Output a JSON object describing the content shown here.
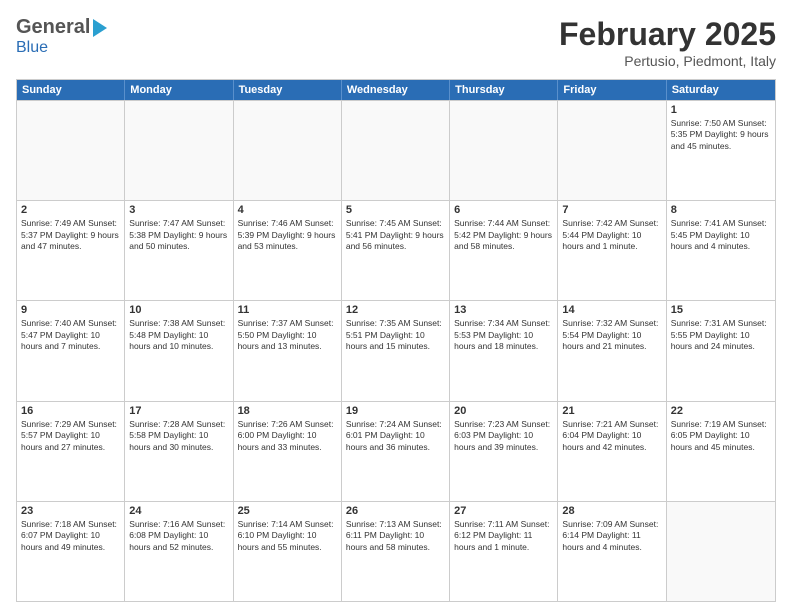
{
  "logo": {
    "general": "General",
    "blue": "Blue"
  },
  "title": "February 2025",
  "location": "Pertusio, Piedmont, Italy",
  "header_days": [
    "Sunday",
    "Monday",
    "Tuesday",
    "Wednesday",
    "Thursday",
    "Friday",
    "Saturday"
  ],
  "weeks": [
    [
      {
        "day": "",
        "info": ""
      },
      {
        "day": "",
        "info": ""
      },
      {
        "day": "",
        "info": ""
      },
      {
        "day": "",
        "info": ""
      },
      {
        "day": "",
        "info": ""
      },
      {
        "day": "",
        "info": ""
      },
      {
        "day": "1",
        "info": "Sunrise: 7:50 AM\nSunset: 5:35 PM\nDaylight: 9 hours and 45 minutes."
      }
    ],
    [
      {
        "day": "2",
        "info": "Sunrise: 7:49 AM\nSunset: 5:37 PM\nDaylight: 9 hours and 47 minutes."
      },
      {
        "day": "3",
        "info": "Sunrise: 7:47 AM\nSunset: 5:38 PM\nDaylight: 9 hours and 50 minutes."
      },
      {
        "day": "4",
        "info": "Sunrise: 7:46 AM\nSunset: 5:39 PM\nDaylight: 9 hours and 53 minutes."
      },
      {
        "day": "5",
        "info": "Sunrise: 7:45 AM\nSunset: 5:41 PM\nDaylight: 9 hours and 56 minutes."
      },
      {
        "day": "6",
        "info": "Sunrise: 7:44 AM\nSunset: 5:42 PM\nDaylight: 9 hours and 58 minutes."
      },
      {
        "day": "7",
        "info": "Sunrise: 7:42 AM\nSunset: 5:44 PM\nDaylight: 10 hours and 1 minute."
      },
      {
        "day": "8",
        "info": "Sunrise: 7:41 AM\nSunset: 5:45 PM\nDaylight: 10 hours and 4 minutes."
      }
    ],
    [
      {
        "day": "9",
        "info": "Sunrise: 7:40 AM\nSunset: 5:47 PM\nDaylight: 10 hours and 7 minutes."
      },
      {
        "day": "10",
        "info": "Sunrise: 7:38 AM\nSunset: 5:48 PM\nDaylight: 10 hours and 10 minutes."
      },
      {
        "day": "11",
        "info": "Sunrise: 7:37 AM\nSunset: 5:50 PM\nDaylight: 10 hours and 13 minutes."
      },
      {
        "day": "12",
        "info": "Sunrise: 7:35 AM\nSunset: 5:51 PM\nDaylight: 10 hours and 15 minutes."
      },
      {
        "day": "13",
        "info": "Sunrise: 7:34 AM\nSunset: 5:53 PM\nDaylight: 10 hours and 18 minutes."
      },
      {
        "day": "14",
        "info": "Sunrise: 7:32 AM\nSunset: 5:54 PM\nDaylight: 10 hours and 21 minutes."
      },
      {
        "day": "15",
        "info": "Sunrise: 7:31 AM\nSunset: 5:55 PM\nDaylight: 10 hours and 24 minutes."
      }
    ],
    [
      {
        "day": "16",
        "info": "Sunrise: 7:29 AM\nSunset: 5:57 PM\nDaylight: 10 hours and 27 minutes."
      },
      {
        "day": "17",
        "info": "Sunrise: 7:28 AM\nSunset: 5:58 PM\nDaylight: 10 hours and 30 minutes."
      },
      {
        "day": "18",
        "info": "Sunrise: 7:26 AM\nSunset: 6:00 PM\nDaylight: 10 hours and 33 minutes."
      },
      {
        "day": "19",
        "info": "Sunrise: 7:24 AM\nSunset: 6:01 PM\nDaylight: 10 hours and 36 minutes."
      },
      {
        "day": "20",
        "info": "Sunrise: 7:23 AM\nSunset: 6:03 PM\nDaylight: 10 hours and 39 minutes."
      },
      {
        "day": "21",
        "info": "Sunrise: 7:21 AM\nSunset: 6:04 PM\nDaylight: 10 hours and 42 minutes."
      },
      {
        "day": "22",
        "info": "Sunrise: 7:19 AM\nSunset: 6:05 PM\nDaylight: 10 hours and 45 minutes."
      }
    ],
    [
      {
        "day": "23",
        "info": "Sunrise: 7:18 AM\nSunset: 6:07 PM\nDaylight: 10 hours and 49 minutes."
      },
      {
        "day": "24",
        "info": "Sunrise: 7:16 AM\nSunset: 6:08 PM\nDaylight: 10 hours and 52 minutes."
      },
      {
        "day": "25",
        "info": "Sunrise: 7:14 AM\nSunset: 6:10 PM\nDaylight: 10 hours and 55 minutes."
      },
      {
        "day": "26",
        "info": "Sunrise: 7:13 AM\nSunset: 6:11 PM\nDaylight: 10 hours and 58 minutes."
      },
      {
        "day": "27",
        "info": "Sunrise: 7:11 AM\nSunset: 6:12 PM\nDaylight: 11 hours and 1 minute."
      },
      {
        "day": "28",
        "info": "Sunrise: 7:09 AM\nSunset: 6:14 PM\nDaylight: 11 hours and 4 minutes."
      },
      {
        "day": "",
        "info": ""
      }
    ]
  ]
}
